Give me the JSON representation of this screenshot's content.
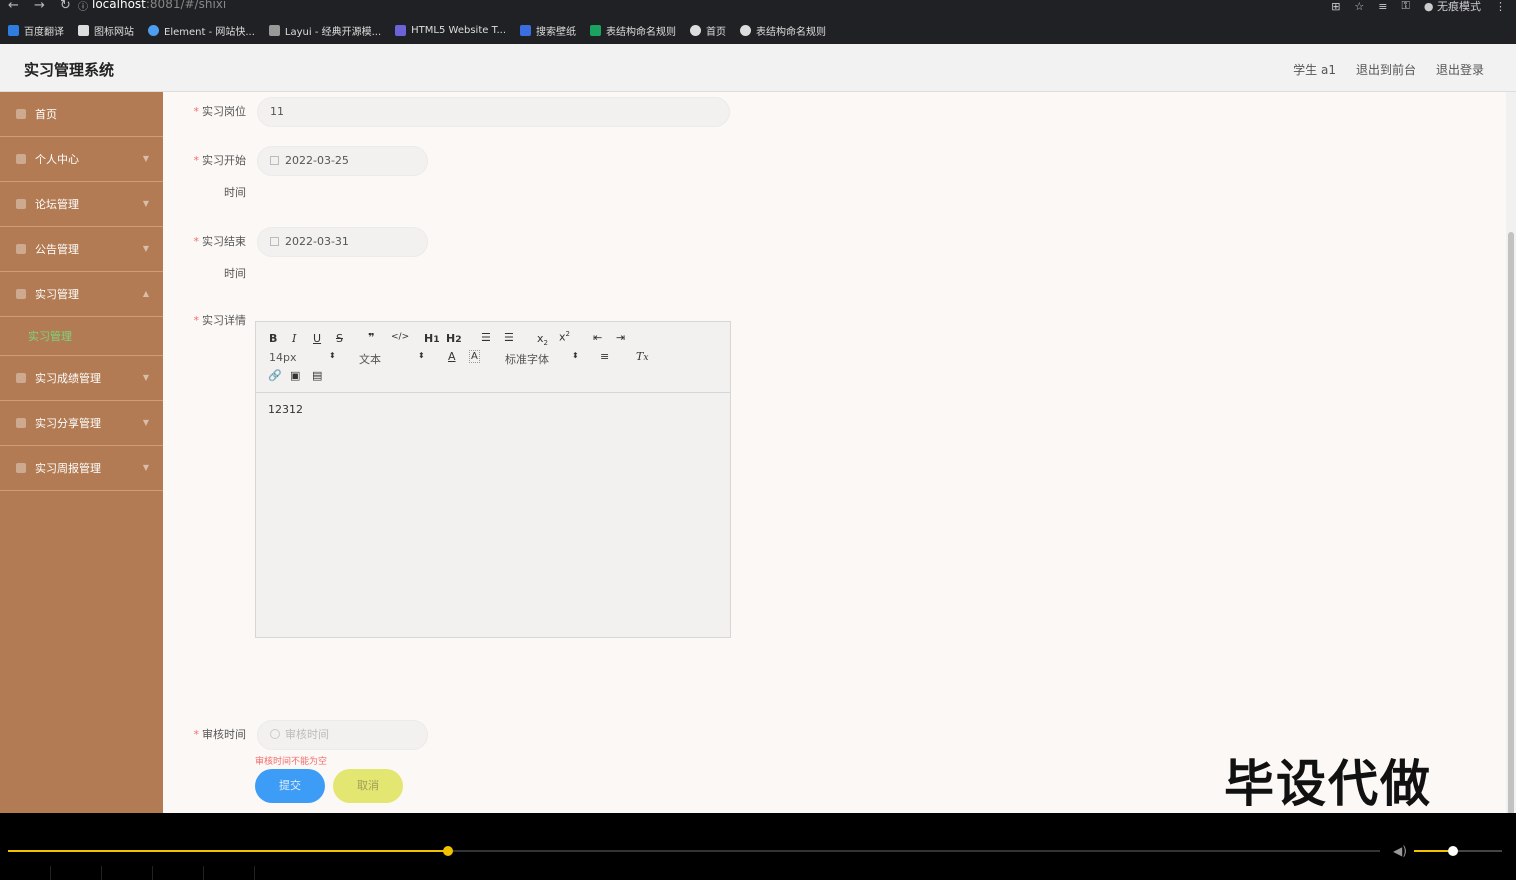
{
  "browser": {
    "url_host": "localhost",
    "url_rest": ":8081/#/shixi",
    "profile": "无痕模式",
    "bookmarks": [
      "百度翻译",
      "图标网站",
      "Element - 网站快...",
      "Layui - 经典开源模...",
      "HTML5 Website T...",
      "搜索壁纸",
      "表结构命名规则",
      "首页",
      "表结构命名规则"
    ]
  },
  "header": {
    "title": "实习管理系统",
    "user": "学生 a1",
    "to_front": "退出到前台",
    "logout": "退出登录"
  },
  "sidebar": {
    "items": [
      {
        "label": "首页"
      },
      {
        "label": "个人中心"
      },
      {
        "label": "论坛管理"
      },
      {
        "label": "公告管理"
      },
      {
        "label": "实习管理"
      },
      {
        "label": "实习成绩管理"
      },
      {
        "label": "实习分享管理"
      },
      {
        "label": "实习周报管理"
      }
    ],
    "sub_active": "实习管理"
  },
  "form": {
    "post_label": "实习岗位",
    "post_value": "11",
    "start_label_1": "实习开始",
    "start_label_2": "时间",
    "start_value": "2022-03-25",
    "end_label_1": "实习结束",
    "end_label_2": "时间",
    "end_value": "2022-03-31",
    "detail_label": "实习详情",
    "review_label": "审核时间",
    "review_placeholder": "审核时间",
    "review_error": "审核时间不能为空",
    "submit": "提交",
    "cancel": "取消"
  },
  "editor": {
    "font_size": "14px",
    "header_select": "文本",
    "font_family": "标准字体",
    "content": "12312"
  },
  "watermark": "毕设代做",
  "player": {
    "progress": 0.321,
    "volume": 0.44
  }
}
